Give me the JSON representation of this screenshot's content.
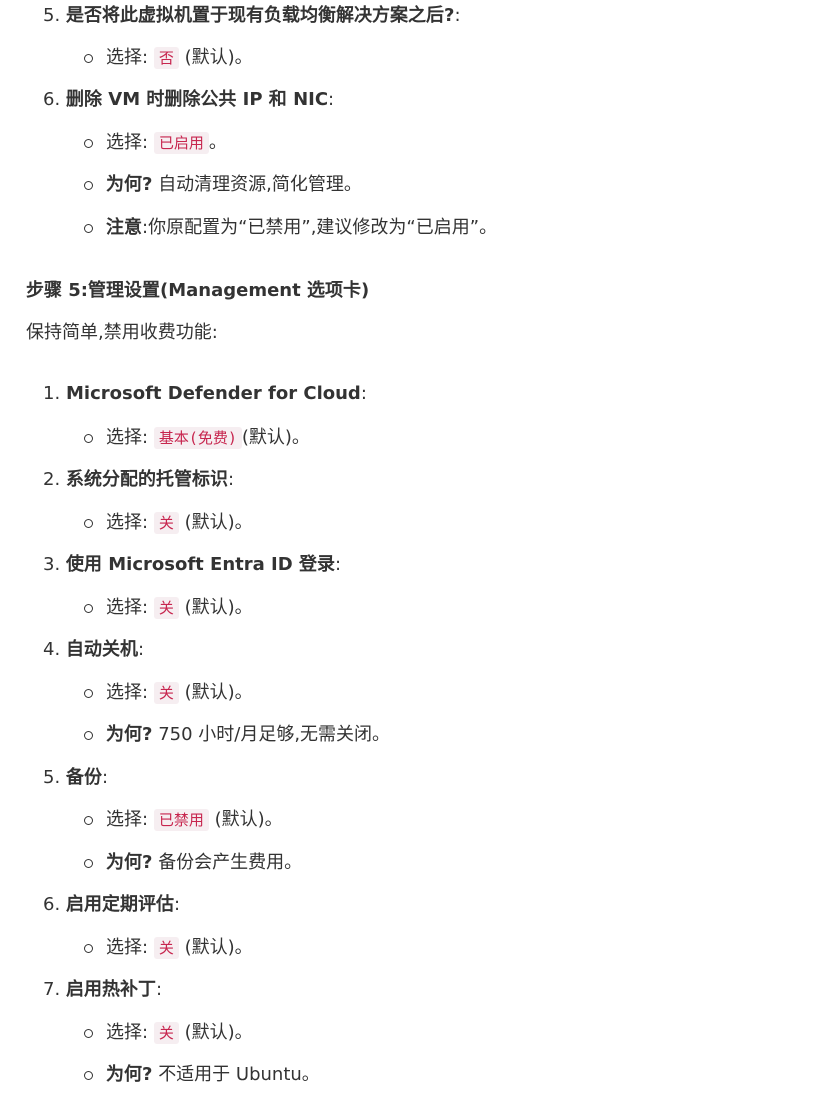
{
  "list1": [
    {
      "num": "5.",
      "title": "是否将此虚拟机置于现有负载均衡解决方案之后?",
      "title_suffix": ":",
      "subs": [
        {
          "label": "选择:",
          "code": "否",
          "after": "(默认)。"
        }
      ]
    },
    {
      "num": "6.",
      "title": "删除 VM 时删除公共 IP 和 NIC",
      "title_suffix": ":",
      "subs": [
        {
          "label": "选择:",
          "code": "已启用",
          "after": "。"
        },
        {
          "bold": "为何?",
          "text": "自动清理资源,简化管理。"
        },
        {
          "bold": "注意",
          "text": ":你原配置为“已禁用”,建议修改为“已启用”。"
        }
      ]
    }
  ],
  "section": {
    "heading": "步骤 5:管理设置(Management 选项卡)",
    "intro": "保持简单,禁用收费功能:"
  },
  "list2": [
    {
      "num": "1.",
      "title": "Microsoft Defender for Cloud",
      "title_suffix": ":",
      "subs": [
        {
          "label": "选择:",
          "code": "基本(免费)",
          "after": "(默认)。"
        }
      ]
    },
    {
      "num": "2.",
      "title": "系统分配的托管标识",
      "title_suffix": ":",
      "subs": [
        {
          "label": "选择:",
          "code": "关",
          "after": "(默认)。"
        }
      ]
    },
    {
      "num": "3.",
      "title": "使用 Microsoft Entra ID 登录",
      "title_suffix": ":",
      "subs": [
        {
          "label": "选择:",
          "code": "关",
          "after": "(默认)。"
        }
      ]
    },
    {
      "num": "4.",
      "title": "自动关机",
      "title_suffix": ":",
      "subs": [
        {
          "label": "选择:",
          "code": "关",
          "after": "(默认)。"
        },
        {
          "bold": "为何?",
          "text": "750 小时/月足够,无需关闭。"
        }
      ]
    },
    {
      "num": "5.",
      "title": "备份",
      "title_suffix": ":",
      "subs": [
        {
          "label": "选择:",
          "code": "已禁用",
          "after": "(默认)。"
        },
        {
          "bold": "为何?",
          "text": "备份会产生费用。"
        }
      ]
    },
    {
      "num": "6.",
      "title": "启用定期评估",
      "title_suffix": ":",
      "subs": [
        {
          "label": "选择:",
          "code": "关",
          "after": "(默认)。"
        }
      ]
    },
    {
      "num": "7.",
      "title": "启用热补丁",
      "title_suffix": ":",
      "subs": [
        {
          "label": "选择:",
          "code": "关",
          "after": "(默认)。"
        },
        {
          "bold": "为何?",
          "text": "不适用于 Ubuntu。"
        }
      ]
    }
  ]
}
